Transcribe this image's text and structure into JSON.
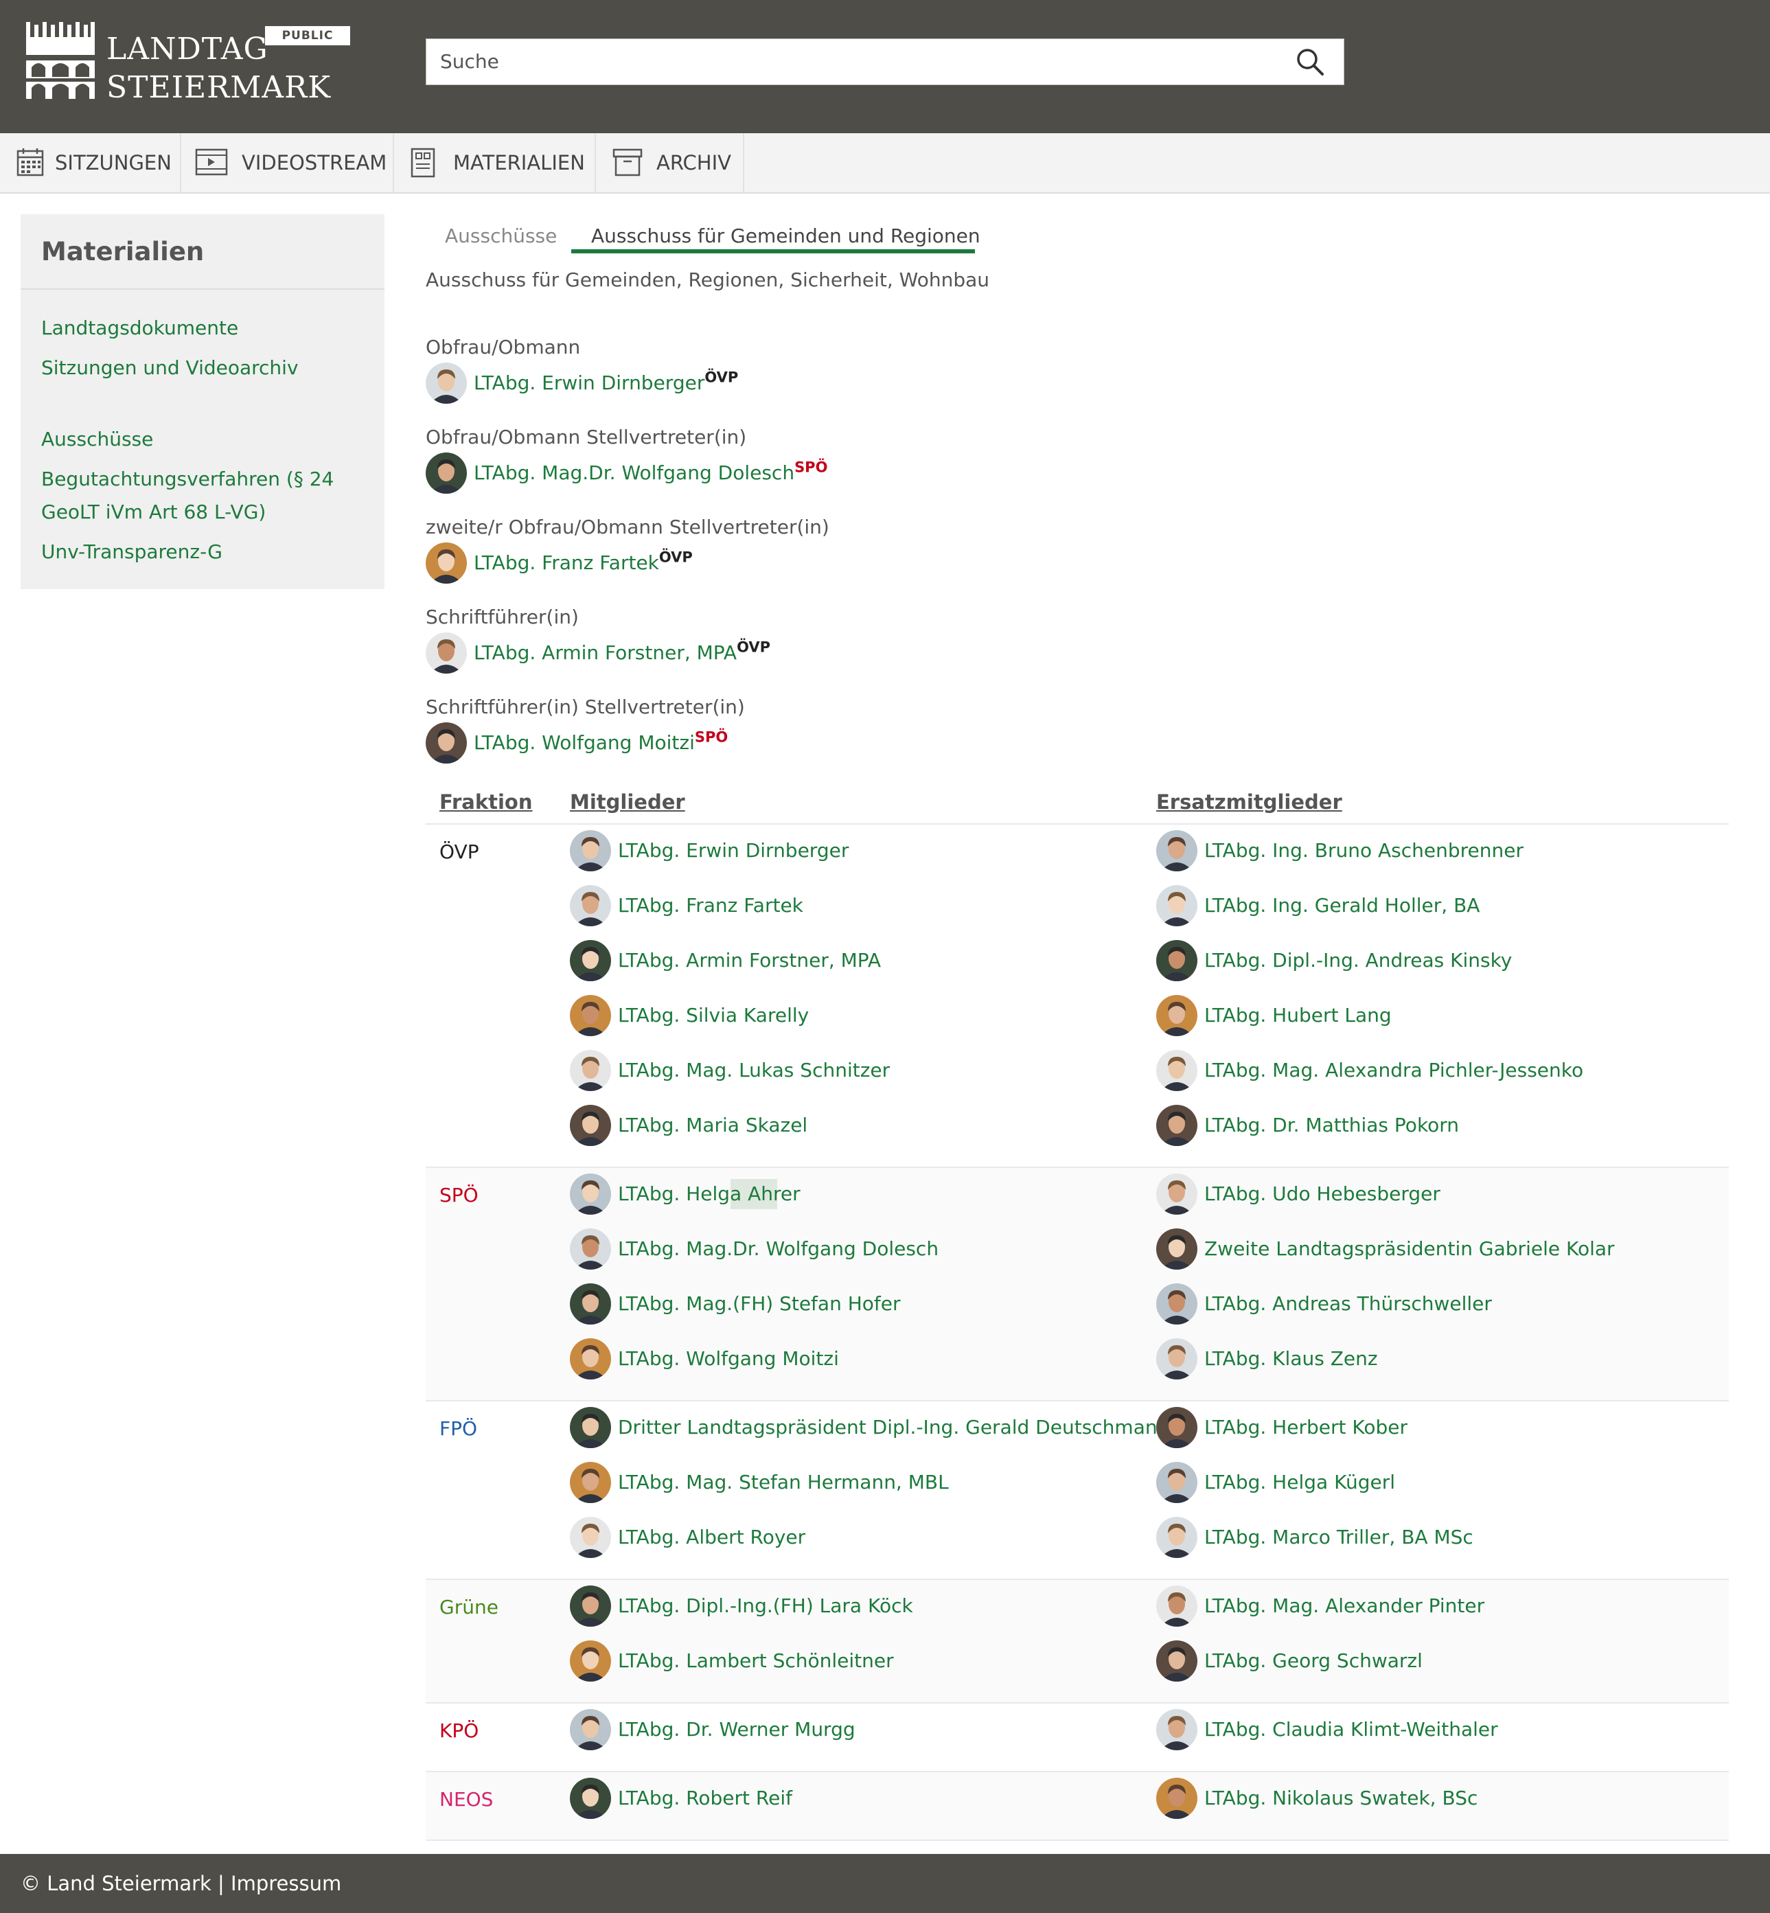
{
  "header": {
    "logo_line1": "LANDTAG",
    "logo_line2": "STEIERMARK",
    "badge": "PUBLIC",
    "search_placeholder": "Suche"
  },
  "nav": [
    {
      "label": "SITZUNGEN",
      "icon": "calendar-icon"
    },
    {
      "label": "VIDEOSTREAM",
      "icon": "video-icon"
    },
    {
      "label": "MATERIALIEN",
      "icon": "document-icon"
    },
    {
      "label": "ARCHIV",
      "icon": "archive-icon"
    }
  ],
  "sidebar": {
    "title": "Materialien",
    "links": [
      "Landtagsdokumente",
      "Sitzungen und Videoarchiv",
      "Ausschüsse",
      "Begutachtungsverfahren (§ 24",
      "GeoLT iVm Art 68 L-VG)",
      "Unv-Transparenz-G"
    ]
  },
  "tabs": {
    "tab1": "Ausschüsse",
    "tab2": "Ausschuss für Gemeinden und Regionen"
  },
  "subtitle": "Ausschuss für Gemeinden, Regionen, Sicherheit, Wohnbau",
  "roles": [
    {
      "role": "Obfrau/Obmann",
      "name": "LTAbg. Erwin Dirnberger",
      "party": "ÖVP"
    },
    {
      "role": "Obfrau/Obmann Stellvertreter(in)",
      "name": "LTAbg. Mag.Dr. Wolfgang Dolesch",
      "party": "SPÖ"
    },
    {
      "role": "zweite/r Obfrau/Obmann Stellvertreter(in)",
      "name": "LTAbg. Franz Fartek",
      "party": "ÖVP"
    },
    {
      "role": "Schriftführer(in)",
      "name": "LTAbg. Armin Forstner, MPA",
      "party": "ÖVP"
    },
    {
      "role": "Schriftführer(in) Stellvertreter(in)",
      "name": "LTAbg. Wolfgang Moitzi",
      "party": "SPÖ"
    }
  ],
  "table": {
    "headers": {
      "fraktion": "Fraktion",
      "mitglieder": "Mitglieder",
      "ersatz": "Ersatzmitglieder"
    },
    "groups": [
      {
        "fraktion": "ÖVP",
        "color": "#222222",
        "members": [
          "LTAbg. Erwin Dirnberger",
          "LTAbg. Franz Fartek",
          "LTAbg. Armin Forstner, MPA",
          "LTAbg. Silvia Karelly",
          "LTAbg. Mag. Lukas Schnitzer",
          "LTAbg. Maria Skazel"
        ],
        "substitutes": [
          "LTAbg. Ing. Bruno Aschenbrenner",
          "LTAbg. Ing. Gerald Holler, BA",
          "LTAbg. Dipl.-Ing. Andreas Kinsky",
          "LTAbg. Hubert Lang",
          "LTAbg. Mag. Alexandra Pichler-Jessenko",
          "LTAbg. Dr. Matthias Pokorn"
        ]
      },
      {
        "fraktion": "SPÖ",
        "color": "#c4001a",
        "members": [
          "LTAbg. Helga Ahrer",
          "LTAbg. Mag.Dr. Wolfgang Dolesch",
          "LTAbg. Mag.(FH) Stefan Hofer",
          "LTAbg. Wolfgang Moitzi"
        ],
        "substitutes": [
          "LTAbg. Udo Hebesberger",
          "Zweite Landtagspräsidentin Gabriele Kolar",
          "LTAbg. Andreas Thürschweller",
          "LTAbg. Klaus Zenz"
        ]
      },
      {
        "fraktion": "FPÖ",
        "color": "#1f5fa8",
        "members": [
          "Dritter Landtagspräsident Dipl.-Ing. Gerald Deutschmann",
          "LTAbg. Mag. Stefan Hermann, MBL",
          "LTAbg. Albert Royer"
        ],
        "substitutes": [
          "LTAbg. Herbert Kober",
          "LTAbg. Helga Kügerl",
          "LTAbg. Marco Triller, BA MSc"
        ]
      },
      {
        "fraktion": "Grüne",
        "color": "#4a8a1c",
        "members": [
          "LTAbg. Dipl.-Ing.(FH) Lara Köck",
          "LTAbg. Lambert Schönleitner"
        ],
        "substitutes": [
          "LTAbg. Mag. Alexander Pinter",
          "LTAbg. Georg Schwarzl"
        ]
      },
      {
        "fraktion": "KPÖ",
        "color": "#c4001a",
        "members": [
          "LTAbg. Dr. Werner Murgg"
        ],
        "substitutes": [
          "LTAbg. Claudia Klimt-Weithaler"
        ]
      },
      {
        "fraktion": "NEOS",
        "color": "#d6246e",
        "members": [
          "LTAbg. Robert Reif"
        ],
        "substitutes": [
          "LTAbg. Nikolaus Swatek, BSc"
        ]
      }
    ]
  },
  "footer": {
    "copyright": "© Land Steiermark",
    "sep": "|",
    "impressum": "Impressum"
  },
  "colors": {
    "header_bg": "#4e4d47",
    "link": "#1d7a3c",
    "highlight": "#dfe8df"
  }
}
